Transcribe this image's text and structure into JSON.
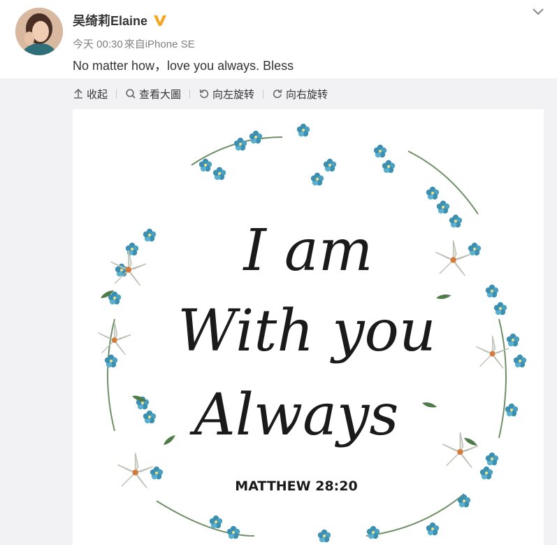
{
  "post": {
    "author": "吴绮莉Elaine",
    "time": "今天 00:30",
    "source": "來自iPhone SE",
    "text": "No matter how，love you always. Bless"
  },
  "icons": {
    "verified": "verified-v-badge",
    "more": "chevron-down-icon"
  },
  "toolbar": {
    "collapse": "收起",
    "view_large": "查看大圖",
    "rotate_left": "向左旋转",
    "rotate_right": "向右旋转"
  },
  "image": {
    "line1": "I am",
    "line2": "With you",
    "line3": "Always",
    "reference": "MATTHEW 28:20"
  },
  "colors": {
    "verified_gold": "#f5a623",
    "panel_bg": "#f2f2f5",
    "flower_blue": "#3b8fb0",
    "leaf_green": "#4f7a4a"
  }
}
